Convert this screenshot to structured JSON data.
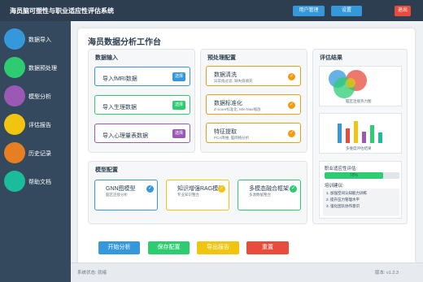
{
  "app": {
    "title": "海员脑可塑性与职业适应性评估系统"
  },
  "topbar": {
    "user_mgmt": "用户管理",
    "settings": "设置",
    "logout": "退出"
  },
  "sidebar": {
    "items": [
      {
        "label": "数据导入",
        "color": "#3498db"
      },
      {
        "label": "数据预处理",
        "color": "#2ecc71"
      },
      {
        "label": "模型分析",
        "color": "#9b59b6"
      },
      {
        "label": "评估报告",
        "color": "#f1c40f"
      },
      {
        "label": "历史记录",
        "color": "#e67e22"
      },
      {
        "label": "帮助文档",
        "color": "#1abc9c"
      }
    ]
  },
  "workbench": {
    "title": "海员数据分析工作台"
  },
  "data_input": {
    "title": "数据输入",
    "cards": [
      {
        "label": "导入fMRI数据",
        "btn": "选择",
        "color": "#3498db"
      },
      {
        "label": "导入生理数据",
        "btn": "选择",
        "color": "#2ecc71"
      },
      {
        "label": "导入心理量表数据",
        "btn": "选择",
        "color": "#9b59b6"
      }
    ]
  },
  "preprocess": {
    "title": "预处理配置",
    "cards": [
      {
        "title": "数据清洗",
        "desc": "异常值过滤, 缺失值填充"
      },
      {
        "title": "数据标准化",
        "desc": "Z-score标准化, Min-Max缩放"
      },
      {
        "title": "特征提取",
        "desc": "PCA降维, 脑网络分析"
      }
    ]
  },
  "model": {
    "title": "模型配置",
    "cards": [
      {
        "title": "GNN图模型",
        "desc": "脑区连接分析",
        "color": "#3498db"
      },
      {
        "title": "知识增强RAG模型",
        "desc": "专业知识整合",
        "color": "#f1c40f"
      },
      {
        "title": "多模态融合框架",
        "desc": "多源数据整合",
        "color": "#2ecc71"
      }
    ]
  },
  "actions": {
    "start": "开始分析",
    "save": "保存配置",
    "export": "导出报告",
    "reset": "重置"
  },
  "results": {
    "title": "评估结果",
    "brain_caption": "脑区连接热力图",
    "bar_caption": "多维度评估结果",
    "bars": [
      {
        "value": 0.75,
        "color": "#3498db"
      },
      {
        "value": 0.55,
        "color": "#e74c3c"
      },
      {
        "value": 0.85,
        "color": "#f1c40f"
      },
      {
        "value": 0.45,
        "color": "#9b59b6"
      },
      {
        "value": 0.7,
        "color": "#2ecc71"
      },
      {
        "value": 0.4,
        "color": "#1abc9c"
      }
    ],
    "fitness_label": "职业适应性评估:",
    "fitness_value": "78%",
    "fitness_fraction": 0.78,
    "suggestion_title": "培训建议:",
    "suggestions": [
      "1. 加强空间认知能力训练",
      "2. 提升压力管理水平",
      "3. 强化团队协作意识"
    ]
  },
  "footer": {
    "status": "系统状态: 就绪",
    "version": "版本: v1.2.3"
  }
}
